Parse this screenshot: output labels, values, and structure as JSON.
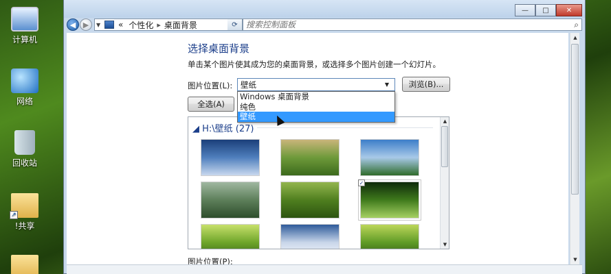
{
  "desktop": {
    "icons": [
      {
        "label": "计算机",
        "icon": "computer-icon"
      },
      {
        "label": "网络",
        "icon": "network-icon"
      },
      {
        "label": "回收站",
        "icon": "recycle-bin-icon"
      },
      {
        "label": "!共享",
        "icon": "shared-folder-icon"
      }
    ]
  },
  "window": {
    "address": {
      "breadcrumb_sep": "«",
      "item1": "个性化",
      "item_sep": "▸",
      "item2": "桌面背景"
    },
    "search": {
      "placeholder": "搜索控制面板"
    },
    "captions": {
      "minimize": "—",
      "maximize": "□",
      "close": "✕"
    }
  },
  "page": {
    "heading": "选择桌面背景",
    "description": "单击某个图片使其成为您的桌面背景，或选择多个图片创建一个幻灯片。",
    "location_label": "图片位置(L):",
    "location_value": "壁纸",
    "location_options": [
      "Windows 桌面背景",
      "纯色",
      "壁纸"
    ],
    "browse_label": "浏览(B)...",
    "select_all_label": "全选(A)",
    "group_title": "H:\\壁纸 (27)",
    "picture_position_label": "图片位置(P):"
  },
  "thumbnails": [
    {
      "name": "pier-sky",
      "checked": false,
      "colors": [
        "#1b3f7a",
        "#4f7fbd",
        "#c8d8ee"
      ]
    },
    {
      "name": "green-field",
      "checked": false,
      "colors": [
        "#c9b57a",
        "#6e9a3a",
        "#3c6a1c"
      ]
    },
    {
      "name": "mountain-lake",
      "checked": false,
      "colors": [
        "#3c7ec9",
        "#a8c9e8",
        "#2f6b2a"
      ]
    },
    {
      "name": "dandelion-field",
      "checked": false,
      "colors": [
        "#9fb7a0",
        "#5d7f5a",
        "#2e4d2c"
      ]
    },
    {
      "name": "clover-meadow",
      "checked": false,
      "colors": [
        "#93b54e",
        "#4f7f1f",
        "#2d5410"
      ]
    },
    {
      "name": "bamboo-forest",
      "checked": true,
      "colors": [
        "#0e2a0a",
        "#3f7a1c",
        "#a6d063"
      ]
    },
    {
      "name": "green-leaves",
      "checked": false,
      "colors": [
        "#c7e06b",
        "#6ea52a",
        "#2f5c12"
      ]
    },
    {
      "name": "snow-peaks",
      "checked": false,
      "colors": [
        "#2e5a9a",
        "#c9d6ea",
        "#ffffff"
      ]
    },
    {
      "name": "green-sprout",
      "checked": false,
      "colors": [
        "#bcd65a",
        "#5f9b26",
        "#2a4d10"
      ]
    }
  ]
}
